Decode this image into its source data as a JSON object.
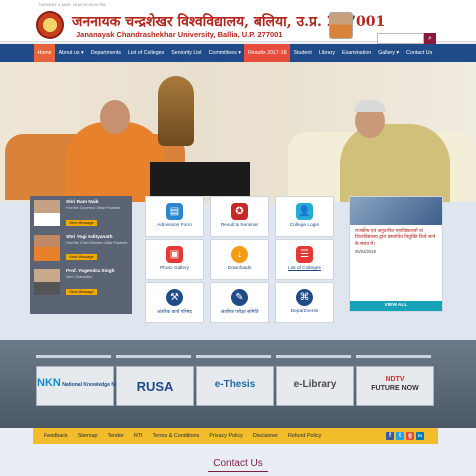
{
  "topbar": {
    "date": "TUESDAY, 6 MAR, 2018 04:48:20 PM"
  },
  "header": {
    "title_hindi": "जननायक चन्द्रशेखर विश्वविद्यालय, बलिया, उ.प्र. 277001",
    "title_english": "Jananayak Chandrashekhar University, Ballia, U.P. 277001",
    "search_placeholder": "",
    "search_icon": "search-icon"
  },
  "nav": {
    "items": [
      "Home",
      "About us ▾",
      "Departments",
      "List of Colleges",
      "Seniority List",
      "Committees ▾",
      "Results 2017-18",
      "Student",
      "Library",
      "Examination",
      "Gallery ▾",
      "Contact Us"
    ]
  },
  "leaders": [
    {
      "name": "Shri Ram Naik",
      "role": "Hon'ble Governor Uttar Pradesh",
      "button": "View Message"
    },
    {
      "name": "Shri Yogi Adityanath",
      "role": "Hon'ble Chief Minister Uttar Pradesh",
      "button": "View Message"
    },
    {
      "name": "Prof. Yogendra Singh",
      "role": "Vice Chancellor",
      "button": "View Message"
    }
  ],
  "tiles": [
    {
      "label": "Admission Form",
      "icon": "document-icon",
      "color": "#2b86d0"
    },
    {
      "label": "Result & Seminar",
      "icon": "award-icon",
      "color": "#c62828"
    },
    {
      "label": "College Login",
      "icon": "user-login-icon",
      "color": "#29a9d6"
    },
    {
      "label": "Photo Gallery",
      "icon": "photo-icon",
      "color": "#e53935"
    },
    {
      "label": "Downloads",
      "icon": "download-icon",
      "color": "#f39c12"
    },
    {
      "label": "List of Colleges",
      "icon": "list-icon",
      "color": "#e53935"
    },
    {
      "label": "अंतरिक कार्य परिषद",
      "icon": "gavel-icon",
      "color": "#1f4c88"
    },
    {
      "label": "अंतरिक परीक्षा समिति",
      "icon": "exam-icon",
      "color": "#1f4c88"
    },
    {
      "label": "Departments",
      "icon": "org-icon",
      "color": "#1f4c88"
    }
  ],
  "news": {
    "text": "राजकीय एवं अनुदानित महाविद्यालयों या विश्वविद्यालय द्वारा प्रस्तावित नियुक्ति किये जाने के संबंध में।",
    "date": "05/03/2018",
    "view_all": "VIEW ALL"
  },
  "partners": [
    {
      "label": "National Knowledge Network",
      "short": "NKN"
    },
    {
      "label": "RUSA",
      "short": "RUSA"
    },
    {
      "label": "e-Thesis",
      "short": "e-Thesis"
    },
    {
      "label": "e-Library",
      "short": "e-Library"
    },
    {
      "label": "FUTURE NOW",
      "short": "NDTV"
    }
  ],
  "footer": {
    "links": [
      "Feedback",
      "Sitemap",
      "Tender",
      "RTI",
      "Terms & Conditions",
      "Privacy Policy",
      "Disclaimer",
      "Refund Policy"
    ],
    "social": [
      {
        "icon": "facebook-icon",
        "glyph": "f",
        "color": "#3b5998"
      },
      {
        "icon": "twitter-icon",
        "glyph": "t",
        "color": "#1da1f2"
      },
      {
        "icon": "googleplus-icon",
        "glyph": "g",
        "color": "#dd4b39"
      },
      {
        "icon": "linkedin-icon",
        "glyph": "in",
        "color": "#0077b5"
      }
    ]
  },
  "contact": {
    "heading": "Contact Us"
  }
}
